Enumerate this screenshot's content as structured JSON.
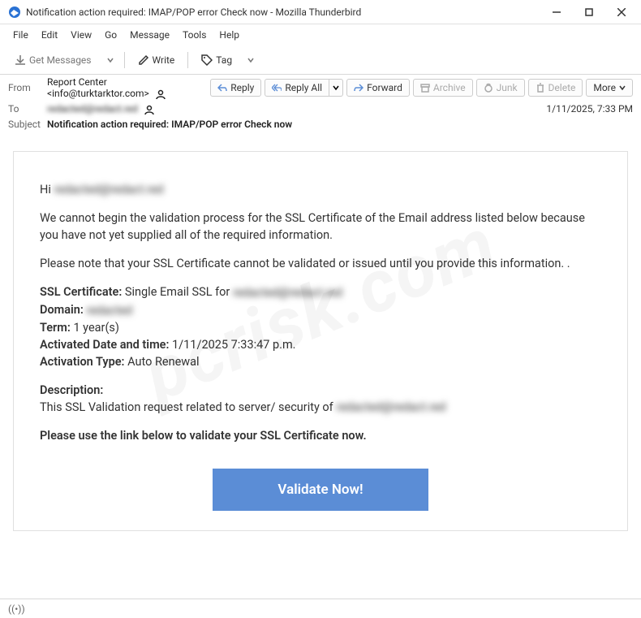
{
  "window": {
    "title": "Notification action required: IMAP/POP error Check now - Mozilla Thunderbird"
  },
  "menu": {
    "file": "File",
    "edit": "Edit",
    "view": "View",
    "go": "Go",
    "message": "Message",
    "tools": "Tools",
    "help": "Help"
  },
  "toolbar": {
    "get_messages": "Get Messages",
    "write": "Write",
    "tag": "Tag"
  },
  "header": {
    "from_label": "From",
    "from_value": "Report Center <info@turktarktor.com>",
    "to_label": "To",
    "to_value": "redacted@redact.red",
    "subject_label": "Subject",
    "subject_value": "Notification action required: IMAP/POP error Check now",
    "date": "1/11/2025, 7:33 PM"
  },
  "actions": {
    "reply": "Reply",
    "reply_all": "Reply All",
    "forward": "Forward",
    "archive": "Archive",
    "junk": "Junk",
    "delete": "Delete",
    "more": "More"
  },
  "email": {
    "greeting_prefix": "Hi",
    "greeting_redacted": "redacted@redact.red",
    "para1": "We cannot begin the validation process for the SSL Certificate of the Email address listed below because you have not yet supplied all of the required information.",
    "para2": "Please note that your SSL Certificate cannot be validated or issued until you provide this information. .",
    "ssl_cert_label": "SSL Certificate:",
    "ssl_cert_value": "Single Email SSL for",
    "ssl_cert_redacted": "redacted@redact.red",
    "domain_label": "Domain:",
    "domain_redacted": "redacted",
    "term_label": "Term:",
    "term_value": "1 year(s)",
    "activated_label": "Activated Date and time:",
    "activated_value": "1/11/2025 7:33:47 p.m.",
    "activation_type_label": "Activation Type:",
    "activation_type_value": "Auto Renewal",
    "desc_label": "Description:",
    "desc_text": "This SSL Validation request related to server/ security of",
    "desc_redacted": "redacted@redact.red",
    "cta_text": "Please use the link below to validate your SSL Certificate now.",
    "button": "Validate Now!"
  },
  "watermark": "pcrisk.com"
}
